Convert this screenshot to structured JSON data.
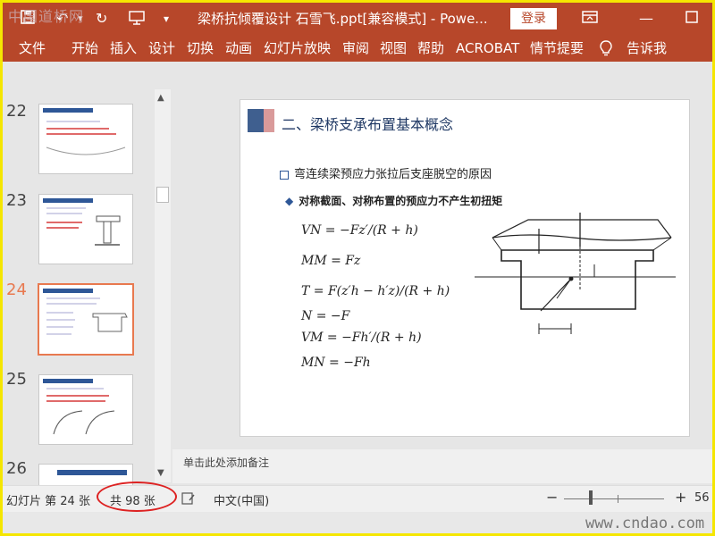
{
  "window": {
    "title": "梁桥抗倾覆设计 石雪飞.ppt[兼容模式] - Powe...",
    "login_label": "登录"
  },
  "ribbon_tabs": [
    "文件",
    "开始",
    "插入",
    "设计",
    "切换",
    "动画",
    "幻灯片放映",
    "审阅",
    "视图",
    "帮助",
    "ACROBAT",
    "情节提要",
    "告诉我"
  ],
  "thumbnails": [
    {
      "number": "22",
      "selected": false
    },
    {
      "number": "23",
      "selected": false
    },
    {
      "number": "24",
      "selected": true
    },
    {
      "number": "25",
      "selected": false
    },
    {
      "number": "26",
      "selected": false
    }
  ],
  "slide": {
    "title": "二、梁桥支承布置基本概念",
    "bullet1": "弯连续梁预应力张拉后支座脱空的原因",
    "bullet2": "对称截面、对称布置的预应力不产生初扭矩",
    "equations": [
      "VN = −Fz′/(R + h)",
      "MM = Fz",
      "T = F(z′h − h′z)/(R + h)",
      "N = −F",
      "VM = −Fh′/(R + h)",
      "MN = −Fh"
    ]
  },
  "notes_placeholder": "单击此处添加备注",
  "status": {
    "slide_label": "幻灯片 第 24 张",
    "total_label": "共 98 张",
    "language": "中文(中国)",
    "zoom": "56"
  },
  "watermarks": {
    "top": "中国道桥网",
    "bottom": "www.cndao.com"
  },
  "colors": {
    "accent": "#b7472a",
    "selection": "#e8794f",
    "highlight_circle": "#dd2222"
  }
}
